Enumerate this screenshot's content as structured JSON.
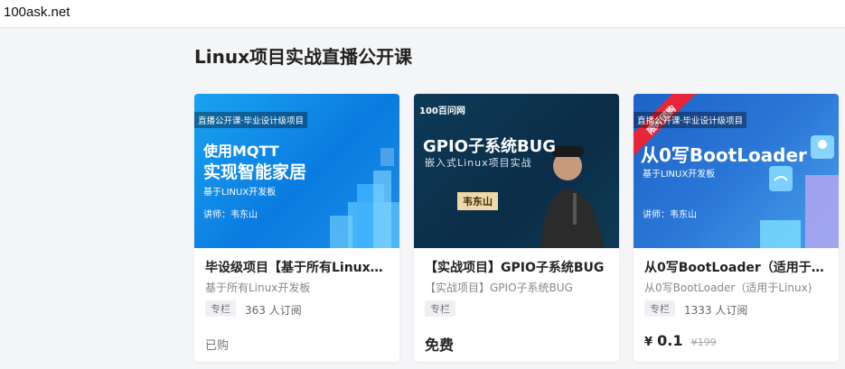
{
  "browser": {
    "domain": "100ask.net"
  },
  "section": {
    "title": "Linux项目实战直播公开课"
  },
  "cards": [
    {
      "thumb": {
        "strip": "直播公开课·毕业设计级项目",
        "line1": "使用MQTT",
        "line2": "实现智能家居",
        "line3": "基于LINUX开发板",
        "lecturer": "讲师：韦东山"
      },
      "title": "毕设级项目【基于所有Linux…",
      "subtitle": "基于所有Linux开发板",
      "tag": "专栏",
      "subscribers": "363 人订阅",
      "footer": "已购"
    },
    {
      "thumb": {
        "logo": "100百问网",
        "title": "GPIO子系统BUG",
        "subtitle": "嵌入式Linux项目实战",
        "name": "韦东山"
      },
      "title": "【实战项目】GPIO子系统BUG",
      "subtitle": "【实战项目】GPIO子系统BUG",
      "tag": "专栏",
      "footer": "免费"
    },
    {
      "thumb": {
        "ribbon": "限时团购",
        "strip": "直播公开课·毕业设计级项目",
        "title": "从0写BootLoader",
        "subtitle": "基于LINUX开发板",
        "lecturer": "讲师：韦东山"
      },
      "title": "从0写BootLoader（适用于Li…",
      "subtitle": "从0写BootLoader（适用于Linux)",
      "tag": "专栏",
      "subscribers": "1333 人订阅",
      "price": {
        "currency": "¥",
        "now": "0.1",
        "original": "¥199"
      }
    }
  ]
}
